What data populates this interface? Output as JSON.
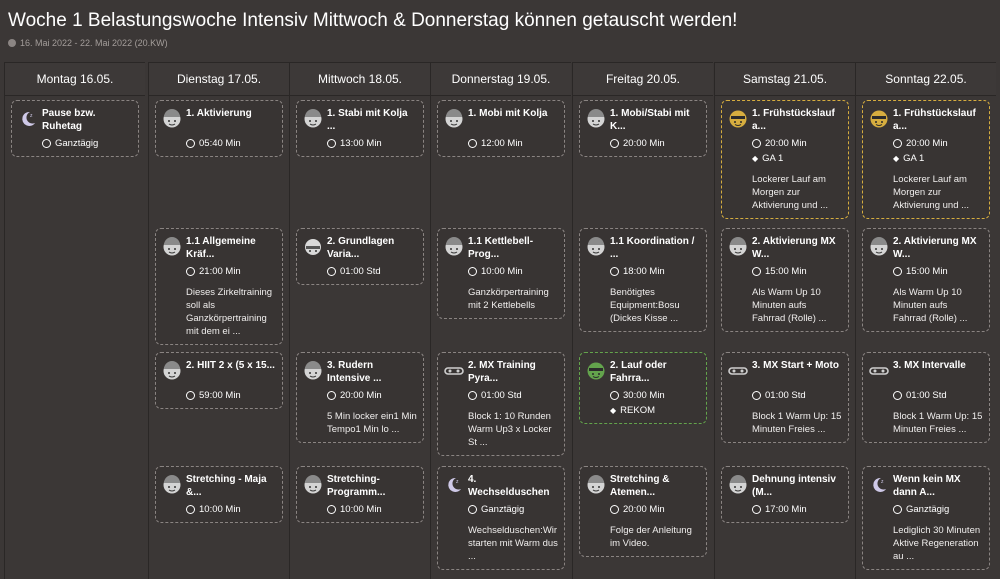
{
  "header": {
    "title": "Woche 1 Belastungswoche Intensiv Mittwoch & Donnerstag können getauscht werden!",
    "subtitle": "16. Mai 2022 - 22. Mai 2022 (20.KW)"
  },
  "days": [
    {
      "label": "Montag 16.05.",
      "cards": [
        {
          "icon": "moon-icon",
          "title": "Pause bzw. Ruhetag",
          "lines": [
            "Ganztägig"
          ],
          "desc": ""
        }
      ]
    },
    {
      "label": "Dienstag 17.05.",
      "cards": [
        {
          "icon": "face-icon",
          "title": "1. Aktivierung",
          "lines": [
            "05:40 Min"
          ],
          "desc": ""
        },
        {
          "icon": "face-icon",
          "title": "1.1 Allgemeine Kräf...",
          "lines": [
            "21:00 Min"
          ],
          "desc": "Dieses Zirkeltraining soll als Ganzkörpertraining mit dem ei ..."
        },
        {
          "icon": "face-icon",
          "title": "2. HIIT 2 x (5 x 15...",
          "lines": [
            "59:00 Min"
          ],
          "desc": ""
        },
        {
          "icon": "face-icon",
          "title": "Stretching - Maja &...",
          "lines": [
            "10:00 Min"
          ],
          "desc": ""
        }
      ]
    },
    {
      "label": "Mittwoch 18.05.",
      "cards": [
        {
          "icon": "face-icon",
          "title": "1. Stabi mit Kolja ...",
          "lines": [
            "13:00 Min"
          ],
          "desc": ""
        },
        {
          "icon": "helmet-icon",
          "title": "2. Grundlagen Varia...",
          "lines": [
            "01:00 Std"
          ],
          "desc": ""
        },
        {
          "icon": "face-icon",
          "title": "3. Rudern Intensive ...",
          "lines": [
            "20:00 Min"
          ],
          "desc": "5 Min locker ein1 Min Tempo1 Min lo ..."
        },
        {
          "icon": "face-icon",
          "title": "Stretching-Programm...",
          "lines": [
            "10:00 Min"
          ],
          "desc": ""
        }
      ]
    },
    {
      "label": "Donnerstag 19.05.",
      "cards": [
        {
          "icon": "face-icon",
          "title": "1. Mobi mit Kolja",
          "lines": [
            "12:00 Min"
          ],
          "desc": ""
        },
        {
          "icon": "face-icon",
          "title": "1.1 Kettlebell-Prog...",
          "lines": [
            "10:00 Min"
          ],
          "desc": "Ganzkörpertraining mit 2 Kettlebells"
        },
        {
          "icon": "goggles-icon",
          "title": "2. MX Training Pyra...",
          "lines": [
            "01:00 Std"
          ],
          "desc": "Block 1: 10 Runden Warm Up3 x Locker St ..."
        },
        {
          "icon": "moon-icon",
          "title": "4. Wechselduschen",
          "lines": [
            "Ganztägig"
          ],
          "desc": "Wechselduschen:Wir starten mit Warm dus ..."
        }
      ]
    },
    {
      "label": "Freitag 20.05.",
      "cards": [
        {
          "icon": "face-icon",
          "title": "1. Mobi/Stabi mit K...",
          "lines": [
            "20:00 Min"
          ],
          "desc": ""
        },
        {
          "icon": "face-icon",
          "title": "1.1 Koordination / ...",
          "lines": [
            "18:00 Min"
          ],
          "desc": "Benötigtes Equipment:Bosu (Dickes Kisse ..."
        },
        {
          "icon": "runner-green-icon",
          "title": "2. Lauf oder Fahrra...",
          "lines": [
            "30:00 Min",
            "REKOM"
          ],
          "desc": "",
          "border": "green"
        },
        {
          "icon": "face-icon",
          "title": "Stretching & Atemen...",
          "lines": [
            "20:00 Min"
          ],
          "desc": "Folge der Anleitung im Video."
        }
      ]
    },
    {
      "label": "Samstag 21.05.",
      "cards": [
        {
          "icon": "runner-gold-icon",
          "title": "1. Frühstückslauf a...",
          "lines": [
            "20:00 Min",
            "GA 1"
          ],
          "desc": "Lockerer Lauf am Morgen zur Aktivierung und ...",
          "border": "gold"
        },
        {
          "icon": "face-icon",
          "title": "2. Aktivierung MX W...",
          "lines": [
            "15:00 Min"
          ],
          "desc": "Als Warm Up 10 Minuten aufs Fahrrad (Rolle) ..."
        },
        {
          "icon": "goggles-icon",
          "title": "3. MX Start + Moto",
          "lines": [
            "01:00 Std"
          ],
          "desc": "Block 1 Warm Up: 15 Minuten Freies ..."
        },
        {
          "icon": "face-icon",
          "title": "Dehnung intensiv (M...",
          "lines": [
            "17:00 Min"
          ],
          "desc": ""
        }
      ]
    },
    {
      "label": "Sonntag 22.05.",
      "cards": [
        {
          "icon": "runner-gold-icon",
          "title": "1. Frühstückslauf a...",
          "lines": [
            "20:00 Min",
            "GA 1"
          ],
          "desc": "Lockerer Lauf am Morgen zur Aktivierung und ...",
          "border": "gold"
        },
        {
          "icon": "face-icon",
          "title": "2. Aktivierung MX W...",
          "lines": [
            "15:00 Min"
          ],
          "desc": "Als Warm Up 10 Minuten aufs Fahrrad (Rolle) ..."
        },
        {
          "icon": "goggles-icon",
          "title": "3. MX Intervalle",
          "lines": [
            "01:00 Std"
          ],
          "desc": "Block 1 Warm Up: 15 Minuten Freies ..."
        },
        {
          "icon": "moon-icon",
          "title": "Wenn kein MX dann A...",
          "lines": [
            "Ganztägig"
          ],
          "desc": "Lediglich 30 Minuten Aktive Regeneration au ..."
        }
      ]
    }
  ],
  "colors": {
    "gold": "#d6ad3f",
    "green": "#63a34c",
    "dashed": "#8a8482"
  }
}
